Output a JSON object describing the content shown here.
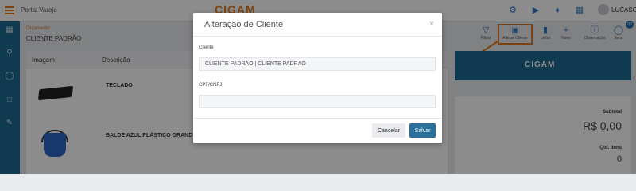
{
  "topbar": {
    "app_name": "Portal Varejo",
    "logo": "CIGAM",
    "user": "LUCASG",
    "icons": [
      "sync-icon",
      "play-icon",
      "bell-icon",
      "apps-grid-icon"
    ]
  },
  "sidebar": {
    "icons": [
      "calculator-icon",
      "search-icon",
      "cart-icon",
      "bag-icon",
      "edit-document-icon"
    ]
  },
  "page": {
    "breadcrumb": "Orçamento",
    "client_title": "CLIENTE PADRÃO"
  },
  "table": {
    "headers": [
      "Imagem",
      "Descrição"
    ],
    "rows": [
      {
        "description": "TECLADO"
      },
      {
        "description": "BALDE AZUL PLÁSTICO GRANDE"
      }
    ]
  },
  "toolbar": {
    "buttons": [
      {
        "label": "Filtrar",
        "icon": "filter-icon"
      },
      {
        "label": "Alterar Cliente",
        "icon": "id-card-icon"
      },
      {
        "label": "Leitor",
        "icon": "barcode-icon"
      },
      {
        "label": "Novo",
        "icon": "plus-icon"
      },
      {
        "label": "Observação",
        "icon": "info-icon"
      },
      {
        "label": "Itens",
        "icon": "cart-icon"
      }
    ],
    "badge": "00"
  },
  "brand_panel": {
    "logo": "CIGAM"
  },
  "summary": {
    "subtotal_label": "Subtotal",
    "subtotal_value": "R$ 0,00",
    "qty_label": "Qtd. Itens",
    "qty_value": "0"
  },
  "modal": {
    "title": "Alteração de Cliente",
    "close": "×",
    "client_label": "Cliente",
    "client_value": "CLIENTE PADRÃO | CLIENTE PADRÃO",
    "cpf_label": "CPF/CNPJ",
    "cpf_value": "",
    "cancel_label": "Cancelar",
    "save_label": "Salvar"
  },
  "colors": {
    "accent": "#e07a24",
    "brand_blue": "#1e6a93",
    "save_button": "#2b6f9b"
  }
}
